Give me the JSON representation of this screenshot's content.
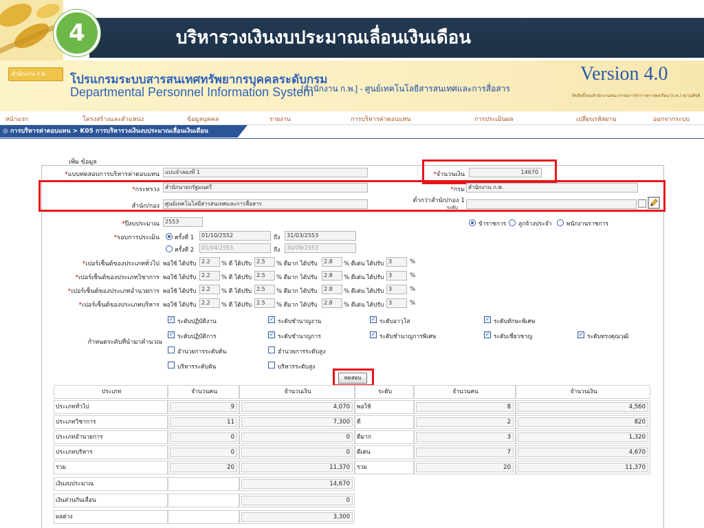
{
  "slide": {
    "number": "4",
    "title": "บริหารวงเงินงบประมาณเลื่อนเงินเดือน"
  },
  "banner": {
    "org_logo": "สำนักงาน ก.พ.",
    "system_name_th": "โปรแกรมระบบสารสนเทศทรัพยากรบุคคลระดับกรม",
    "system_name_en": "Departmental Personnel Information System",
    "office": "[สำนักงาน ก.พ.] - ศูนย์เทคโนโลยีสารสนเทศและการสื่อสาร",
    "version": "Version 4.0",
    "version_sub": "ลิขสิทธิ์ของสำนักงานคณะกรรมการข้าราชการพลเรือน (ก.พ.) สงวนลิขสิทธิ์"
  },
  "menu": [
    "หน้าแรก",
    "โครงสร้างและตำแหน่ง",
    "ข้อมูลบุคคล",
    "รายงาน",
    "การบริหารค่าตอบแทน",
    "การประเมินผล",
    "เปลี่ยนรหัสผ่าน",
    "ออกจากระบบ"
  ],
  "breadcrumb": "◎ การบริหารค่าตอบแทน > K05 การบริหารวงเงินงบประมาณเลื่อนเงินเดือน",
  "form": {
    "section_title": "เพิ่ม ข้อมูล",
    "pattern_label": "แบบทดสอบการบริหารค่าตอบแทน",
    "pattern_value": "แบบจำลองที่ 1",
    "amount_label": "จำนวนเงิน",
    "amount_value": "14670",
    "ministry_label": "กระทรวง",
    "ministry_value": "สำนักนายกรัฐมนตรี",
    "dept_label": "กรม",
    "dept_value": "สำนักงาน ก.พ.",
    "division_label": "สำนัก/กอง",
    "division_value": "ศูนย์เทคโนโลยีสารสนเทศและการสื่อสาร",
    "below_label": "ต่ำกว่าสำนัก/กอง 1",
    "below_label2": "ระดับ",
    "fiscal_year_label": "ปีงบประมาณ",
    "fiscal_year_value": "2553",
    "staff_types": [
      "ข้าราชการ",
      "ลูกจ้างประจำ",
      "พนักงานราชการ"
    ],
    "round_label": "รอบการประเมิน",
    "round1": "ครั้งที่ 1",
    "round1_from": "01/10/2552",
    "round1_to": "31/03/2553",
    "round2": "ครั้งที่ 2",
    "round2_from": "01/04/2553",
    "round2_to": "30/09/2553",
    "to_word": "ถึง",
    "percent_rows": [
      {
        "label": "เปอร์เซ็นต์ของประเภททั่วไป",
        "v1": "2.2",
        "v2": "2.5",
        "v3": "2.8",
        "v4": "3"
      },
      {
        "label": "เปอร์เซ็นต์ของประเภทวิชาการ",
        "v1": "2.2",
        "v2": "2.5",
        "v3": "2.8",
        "v4": "3"
      },
      {
        "label": "เปอร์เซ็นต์ของประเภทอำนวยการ",
        "v1": "2.2",
        "v2": "2.5",
        "v3": "2.8",
        "v4": "3"
      },
      {
        "label": "เปอร์เซ็นต์ของประเภทบริหาร",
        "v1": "2.2",
        "v2": "2.5",
        "v3": "2.8",
        "v4": "3"
      }
    ],
    "pct_fair": "พอใช้ ได้ปรับ",
    "pct_good": "% ดี ได้ปรับ",
    "pct_verygood": "% ดีมาก ได้ปรับ",
    "pct_excellent": "% ดีเด่น ได้ปรับ",
    "pct_sign": "%",
    "levels_label": "กำหนดระดับที่นำมาคำนวณ",
    "levels": [
      {
        "label": "ระดับปฏิบัติงาน",
        "checked": true
      },
      {
        "label": "ระดับชำนาญงาน",
        "checked": true
      },
      {
        "label": "ระดับอาวุโส",
        "checked": true
      },
      {
        "label": "ระดับทักษะพิเศษ",
        "checked": true
      },
      {
        "label": "ระดับปฏิบัติการ",
        "checked": true
      },
      {
        "label": "ระดับชำนาญการ",
        "checked": true
      },
      {
        "label": "ระดับชำนาญการพิเศษ",
        "checked": true
      },
      {
        "label": "ระดับเชี่ยวชาญ",
        "checked": true
      },
      {
        "label": "ระดับทรงคุณวุฒิ",
        "checked": true
      },
      {
        "label": "อำนวยการระดับต้น",
        "checked": false
      },
      {
        "label": "อำนวยการระดับสูง",
        "checked": false
      },
      {
        "label": "บริหารระดับต้น",
        "checked": false
      },
      {
        "label": "บริหารระดับสูง",
        "checked": false
      }
    ],
    "test_button": "ทดสอบ"
  },
  "table_left": {
    "headers": [
      "ประเภท",
      "จำนวนคน",
      "จำนวนเงิน"
    ],
    "rows": [
      {
        "type": "ประเภททั่วไป",
        "people": "9",
        "money": "4,070"
      },
      {
        "type": "ประเภทวิชาการ",
        "people": "11",
        "money": "7,300"
      },
      {
        "type": "ประเภทอำนวยการ",
        "people": "0",
        "money": "0"
      },
      {
        "type": "ประเภทบริหาร",
        "people": "0",
        "money": "0"
      },
      {
        "type": "รวม",
        "people": "20",
        "money": "11,370"
      }
    ],
    "summary": [
      {
        "label": "เงินงบประมาณ",
        "value": "14,670"
      },
      {
        "label": "เงินส่วนกันเลื่อน",
        "value": "0"
      },
      {
        "label": "ผลต่าง",
        "value": "3,300"
      }
    ]
  },
  "table_right": {
    "headers": [
      "ระดับ",
      "จำนวนคน",
      "จำนวนเงิน"
    ],
    "rows": [
      {
        "level": "พอใช้",
        "people": "8",
        "money": "4,560"
      },
      {
        "level": "ดี",
        "people": "2",
        "money": "820"
      },
      {
        "level": "ดีมาก",
        "people": "3",
        "money": "1,320"
      },
      {
        "level": "ดีเด่น",
        "people": "7",
        "money": "4,670"
      },
      {
        "level": "รวม",
        "people": "20",
        "money": "11,370"
      }
    ]
  },
  "colors": {
    "highlight": "#e8141b",
    "title_bar": "#1f3650",
    "slide_number_bg": "#6cb848",
    "breadcrumb_bg": "#2b5597",
    "menu_text": "#a0582a",
    "system_name": "#2e62b8"
  }
}
